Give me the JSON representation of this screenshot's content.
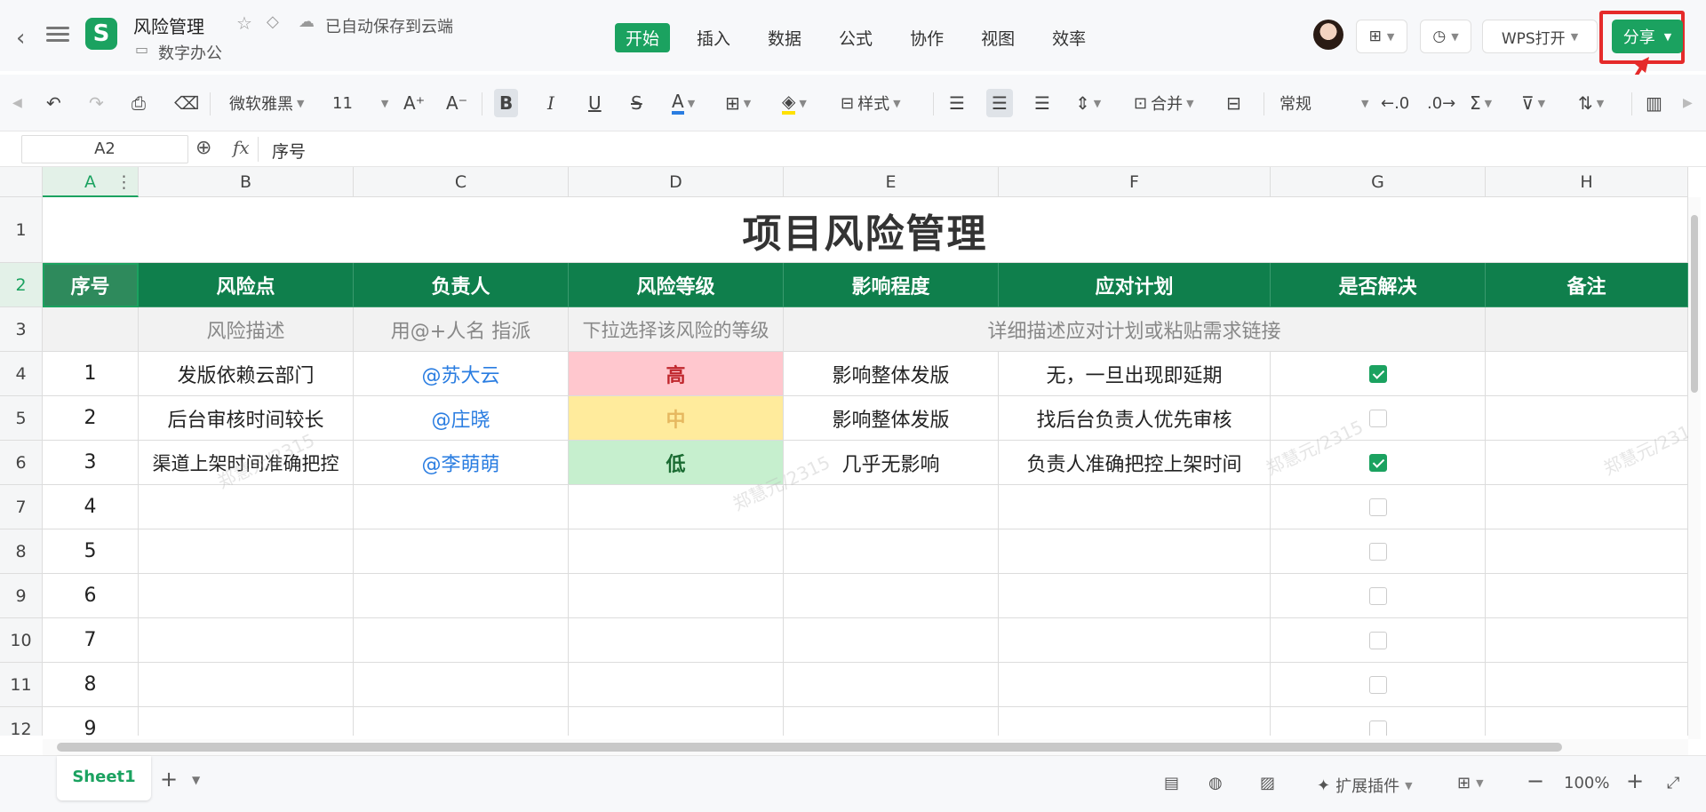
{
  "titlebar": {
    "doc_title": "风险管理",
    "autosave": "已自动保存到云端",
    "folder": "数字办公",
    "logo_letter": "S",
    "menus": [
      "开始",
      "插入",
      "数据",
      "公式",
      "协作",
      "视图",
      "效率"
    ],
    "active_menu": "开始",
    "wps_open": "WPS打开",
    "share": "分享"
  },
  "toolbar": {
    "font_name": "微软雅黑",
    "font_size": "11",
    "style_label": "样式",
    "merge_label": "合并",
    "number_format": "常规"
  },
  "formula_bar": {
    "cell_ref": "A2",
    "content": "序号"
  },
  "columns": [
    "A",
    "B",
    "C",
    "D",
    "E",
    "F",
    "G",
    "H"
  ],
  "rows": [
    "1",
    "2",
    "3",
    "4",
    "5",
    "6",
    "7",
    "8",
    "9",
    "10",
    "11",
    "12"
  ],
  "sheet": {
    "title": "项目风险管理",
    "headers": [
      "序号",
      "风险点",
      "负责人",
      "风险等级",
      "影响程度",
      "应对计划",
      "是否解决",
      "备注"
    ],
    "desc": {
      "risk": "风险描述",
      "owner": "用@+人名 指派",
      "level": "下拉选择该风险的等级",
      "plan": "详细描述应对计划或粘贴需求链接"
    },
    "records": [
      {
        "no": "1",
        "risk": "发版依赖云部门",
        "owner": "@苏大云",
        "level": "高",
        "impact": "影响整体发版",
        "plan": "无，一旦出现即延期",
        "solved": true
      },
      {
        "no": "2",
        "risk": "后台审核时间较长",
        "owner": "@庄晓",
        "level": "中",
        "impact": "影响整体发版",
        "plan": "找后台负责人优先审核",
        "solved": false
      },
      {
        "no": "3",
        "risk": "渠道上架时间准确把控",
        "owner": "@李萌萌",
        "level": "低",
        "impact": "几乎无影响",
        "plan": "负责人准确把控上架时间",
        "solved": true
      }
    ],
    "empty_numbers": [
      "4",
      "5",
      "6",
      "7",
      "8",
      "9"
    ]
  },
  "statusbar": {
    "sheet_tab": "Sheet1",
    "extensions": "扩展插件",
    "zoom": "100%"
  },
  "watermark": "郑慧元/2315",
  "colors": {
    "brand": "#1ba260",
    "header_bg": "#0f7f4c",
    "high_bg": "#ffc7ce",
    "mid_bg": "#ffeb9c",
    "low_bg": "#c6efce",
    "highlight_box": "#e52a2a"
  }
}
